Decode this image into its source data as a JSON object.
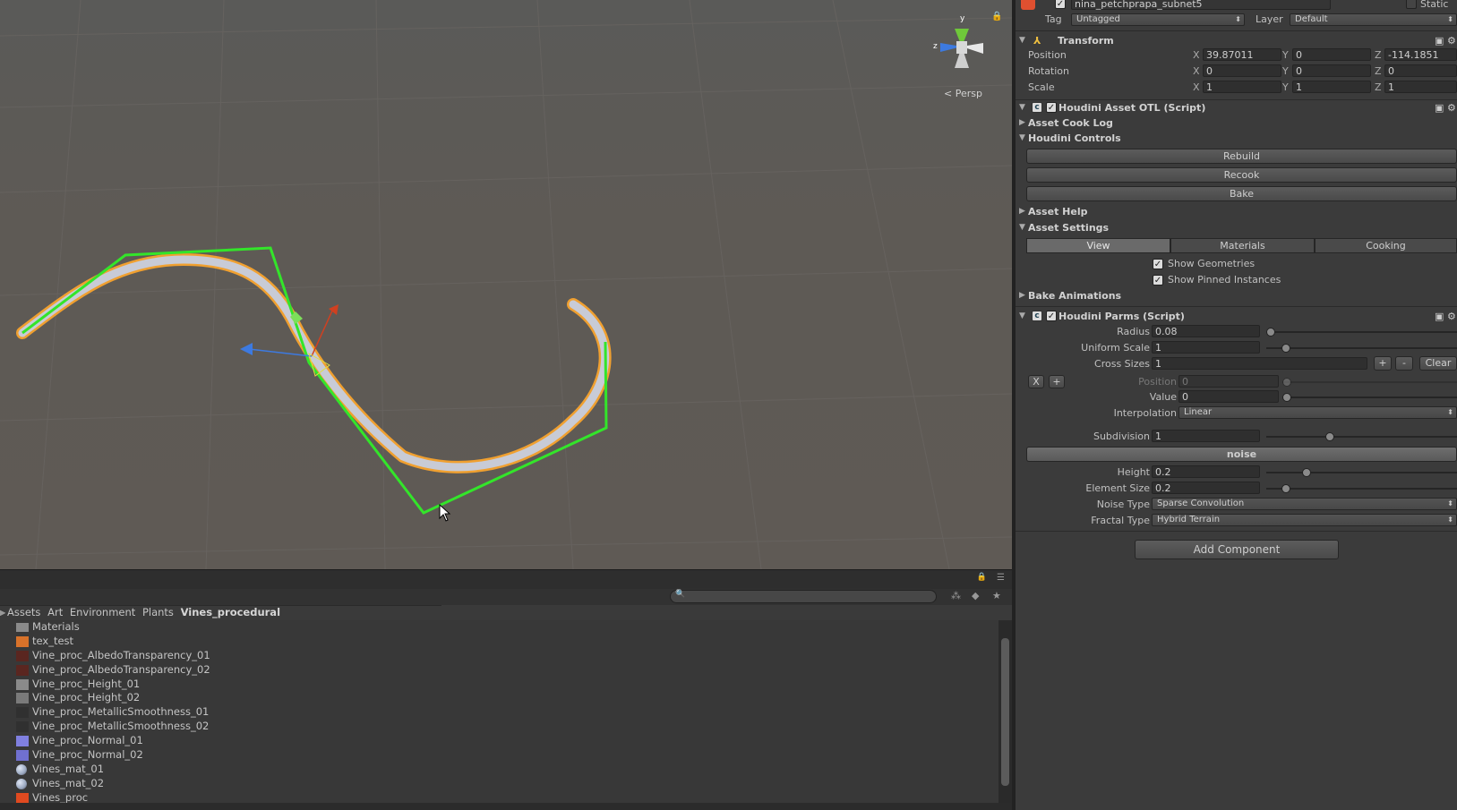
{
  "scene": {
    "persp_label": "Persp",
    "gizmo_axis_y": "y",
    "gizmo_axis_z": "z"
  },
  "project": {
    "breadcrumb": [
      "Assets",
      "Art",
      "Environment",
      "Plants",
      "Vines_procedural"
    ],
    "files": [
      {
        "name": "Materials",
        "icon": "folder-icon",
        "color": "#8a8a8a"
      },
      {
        "name": "tex_test",
        "icon": "texture-icon",
        "color": "#d8722a"
      },
      {
        "name": "Vine_proc_AlbedoTransparency_01",
        "icon": "texture-icon",
        "color": "#5a2620"
      },
      {
        "name": "Vine_proc_AlbedoTransparency_02",
        "icon": "texture-icon",
        "color": "#5a2620"
      },
      {
        "name": "Vine_proc_Height_01",
        "icon": "texture-icon",
        "color": "#8a8a8a"
      },
      {
        "name": "Vine_proc_Height_02",
        "icon": "texture-icon",
        "color": "#7a7a7a"
      },
      {
        "name": "Vine_proc_MetallicSmoothness_01",
        "icon": "texture-icon",
        "color": "#303030"
      },
      {
        "name": "Vine_proc_MetallicSmoothness_02",
        "icon": "texture-icon",
        "color": "#303030"
      },
      {
        "name": "Vine_proc_Normal_01",
        "icon": "texture-icon",
        "color": "#8080e0"
      },
      {
        "name": "Vine_proc_Normal_02",
        "icon": "texture-icon",
        "color": "#7070d0"
      },
      {
        "name": "Vines_mat_01",
        "icon": "material-sphere-icon",
        "color": "#9aa8c0"
      },
      {
        "name": "Vines_mat_02",
        "icon": "material-sphere-icon",
        "color": "#9aa8c0"
      },
      {
        "name": "Vines_proc",
        "icon": "houdini-asset-icon",
        "color": "#e04a20"
      }
    ]
  },
  "inspector": {
    "object_name": "nina_petchprapa_subnet5",
    "static_label": "Static",
    "tag_label": "Tag",
    "tag_value": "Untagged",
    "layer_label": "Layer",
    "layer_value": "Default",
    "transform": {
      "title": "Transform",
      "position_label": "Position",
      "rotation_label": "Rotation",
      "scale_label": "Scale",
      "position": {
        "x": "39.87011",
        "y": "0",
        "z": "-114.1851"
      },
      "rotation": {
        "x": "0",
        "y": "0",
        "z": "0"
      },
      "scale": {
        "x": "1",
        "y": "1",
        "z": "1"
      }
    },
    "otl": {
      "title": "Houdini Asset OTL (Script)",
      "cook_log": "Asset Cook Log",
      "controls": "Houdini Controls",
      "rebuild": "Rebuild",
      "recook": "Recook",
      "bake": "Bake",
      "help": "Asset Help",
      "settings": "Asset Settings",
      "tabs": [
        "View",
        "Materials",
        "Cooking"
      ],
      "show_geometries": "Show Geometries",
      "show_pinned": "Show Pinned Instances",
      "bake_anim": "Bake Animations"
    },
    "parms": {
      "title": "Houdini Parms (Script)",
      "radius_label": "Radius",
      "radius": "0.08",
      "uniform_scale_label": "Uniform Scale",
      "uniform_scale": "1",
      "cross_sizes_label": "Cross Sizes",
      "cross_sizes": "1",
      "plus": "+",
      "minus": "-",
      "clear": "Clear",
      "x_btn": "X",
      "add_btn": "+",
      "position_label": "Position",
      "position": "0",
      "value_label": "Value",
      "value": "0",
      "interp_label": "Interpolation",
      "interp": "Linear",
      "subdivision_label": "Subdivision",
      "subdivision": "1",
      "noise": "noise",
      "height_label": "Height",
      "height": "0.2",
      "element_size_label": "Element Size",
      "element_size": "0.2",
      "noise_type_label": "Noise Type",
      "noise_type": "Sparse Convolution",
      "fractal_type_label": "Fractal Type",
      "fractal_type": "Hybrid Terrain"
    },
    "add_component": "Add Component"
  }
}
